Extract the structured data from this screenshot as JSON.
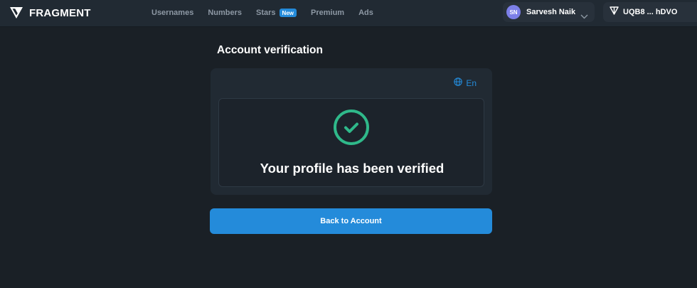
{
  "header": {
    "logo_text": "FRAGMENT",
    "nav": [
      {
        "label": "Usernames"
      },
      {
        "label": "Numbers"
      },
      {
        "label": "Stars",
        "badge": "New"
      },
      {
        "label": "Premium"
      },
      {
        "label": "Ads"
      }
    ],
    "user": {
      "initials": "SN",
      "name": "Sarvesh Naik"
    },
    "wallet": {
      "address": "UQB8 ... hDVO"
    }
  },
  "main": {
    "title": "Account verification",
    "language": "En",
    "status_text": "Your profile has been verified",
    "back_button_label": "Back to Account"
  },
  "colors": {
    "accent": "#248bda",
    "success": "#2fb98a",
    "background": "#1a2026",
    "surface": "#212a33",
    "avatar": "#7c7fe8"
  },
  "icons": {
    "logo": "fragment-logo-icon",
    "language": "globe-icon",
    "status": "check-circle-icon",
    "dropdown": "chevron-down-icon",
    "wallet": "ton-icon"
  }
}
